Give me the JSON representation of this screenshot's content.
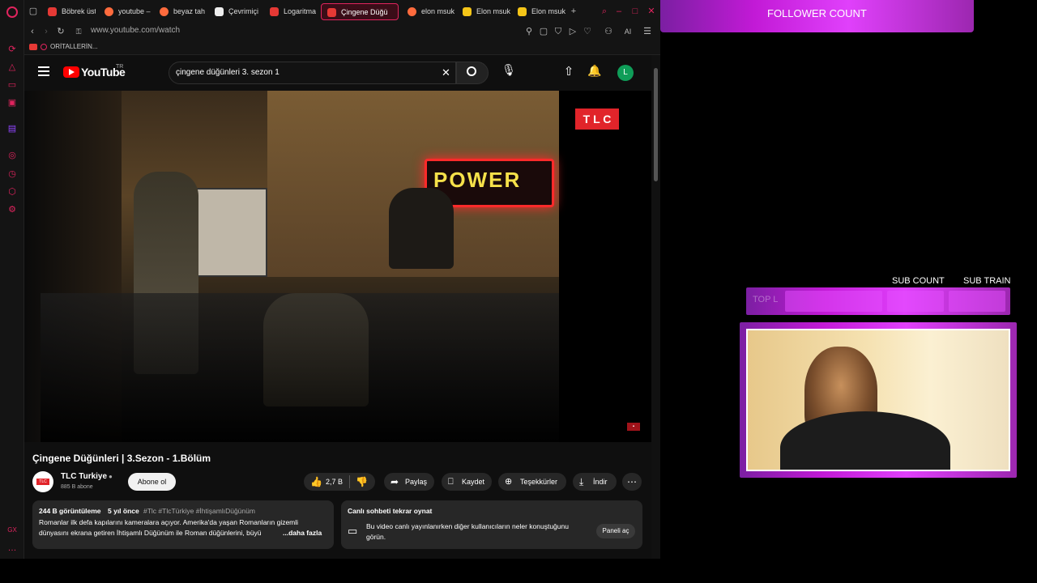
{
  "tabs": [
    {
      "label": "Böbrek üst",
      "color": "#e53935"
    },
    {
      "label": "youtube –",
      "color": "#ff6b3d"
    },
    {
      "label": "beyaz tah",
      "color": "#ff6b3d"
    },
    {
      "label": "Çevrimiçi",
      "color": "#ffffff"
    },
    {
      "label": "Logaritma",
      "color": "#e53935"
    },
    {
      "label": "Çingene Düğü",
      "color": "#e53935"
    },
    {
      "label": "elon msuk",
      "color": "#ff6b3d"
    },
    {
      "label": "Elon msuk",
      "color": "#f5c518"
    },
    {
      "label": "Elon msuk",
      "color": "#f5c518"
    }
  ],
  "address": {
    "url": "www.youtube.com/watch",
    "ai_label": "AI"
  },
  "bookmark": {
    "label": "ORİTALLERİN..."
  },
  "youtube": {
    "logo_text": "YouTube",
    "region": "TR",
    "search_value": "çingene düğünleri 3. sezon 1",
    "avatar_letter": "L",
    "video_title": "Çingene Düğünleri | 3.Sezon - 1.Bölüm",
    "channel_name": "TLC Turkiye",
    "subscribers": "885 B abone",
    "subscribe_label": "Abone ol",
    "likes": "2,7 B",
    "share_label": "Paylaş",
    "save_label": "Kaydet",
    "thanks_label": "Teşekkürler",
    "download_label": "İndir",
    "views": "244 B görüntüleme",
    "age": "5 yıl önce",
    "hashtags": "#Tlc #TlcTürkiye #İhtişamlıDüğünüm",
    "description_line1": "Romanlar ilk defa kapılarını kameralara açıyor. Amerika'da yaşan Romanların gizemli",
    "description_line2": "dünyasını ekrana getiren İhtişamlı Düğünüm ile Roman düğünlerini, büyü",
    "more_label": "...daha fazla",
    "chat_title": "Canlı sohbeti tekrar oynat",
    "chat_text_line1": "Bu video canlı yayınlanırken diğer kullanıcıların neler konuştuğunu",
    "chat_text_line2": "görün.",
    "chat_button": "Paneli aç",
    "tlc_logo": "T L C",
    "power_sign": "POWER",
    "channel_logo": "TLC"
  },
  "overlay": {
    "follower_count": "FOLLOWER COUNT",
    "sub_count": "SUB COUNT",
    "sub_train": "SUB TRAIN",
    "top_label": "TOP L"
  },
  "colors": {
    "accent": "#e0245e",
    "pink": "#d020e8",
    "youtube_red": "#ff0000"
  }
}
